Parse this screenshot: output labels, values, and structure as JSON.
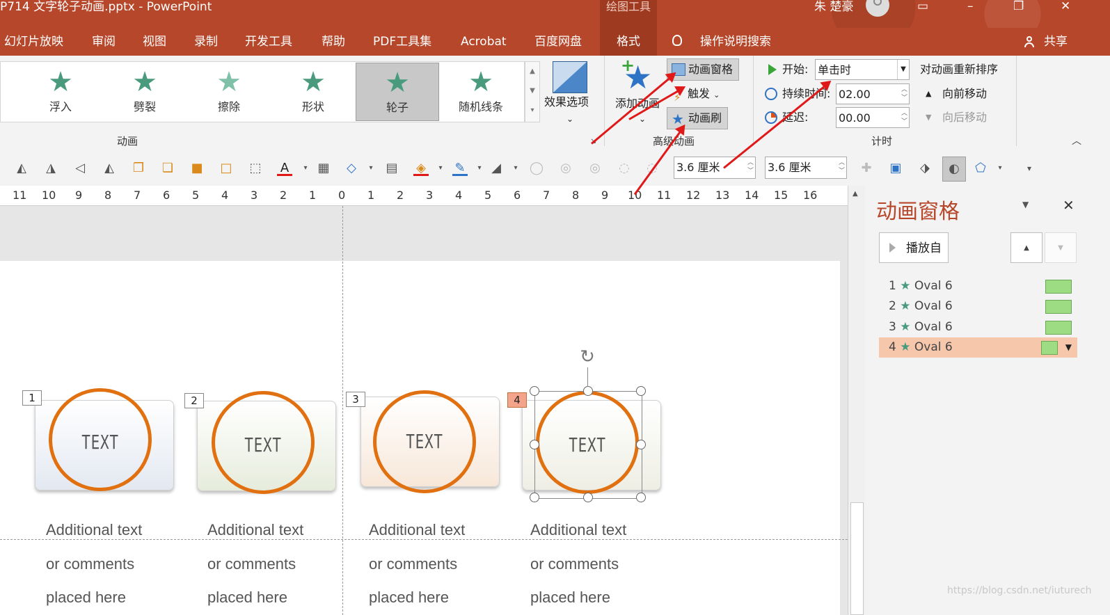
{
  "window": {
    "title": "P714 文字轮子动画.pptx  -  PowerPoint",
    "context_tab": "绘图工具",
    "user": "朱 楚豪",
    "controls": [
      "▭",
      "–",
      "❐",
      "✕"
    ]
  },
  "menu": {
    "items": [
      "幻灯片放映",
      "审阅",
      "视图",
      "录制",
      "开发工具",
      "帮助",
      "PDF工具集",
      "Acrobat",
      "百度网盘",
      "格式"
    ],
    "search": "操作说明搜索",
    "share": "共享"
  },
  "ribbon": {
    "gallery": [
      {
        "label": "浮入",
        "icon": "float-in-star-icon"
      },
      {
        "label": "劈裂",
        "icon": "split-star-icon"
      },
      {
        "label": "擦除",
        "icon": "wipe-star-icon"
      },
      {
        "label": "形状",
        "icon": "shape-star-icon"
      },
      {
        "label": "轮子",
        "icon": "wheel-star-icon",
        "selected": true
      },
      {
        "label": "随机线条",
        "icon": "random-bars-star-icon"
      }
    ],
    "effect_options": "效果选项",
    "effect_options_arrow": "⌄",
    "group_animation": "动画",
    "add_animation": "添加动画",
    "add_animation_arrow": "⌄",
    "animation_pane_btn": "动画窗格",
    "trigger": "触发",
    "trigger_arrow": "⌄",
    "animation_painter": "动画刷",
    "group_advanced": "高级动画",
    "start_label": "开始:",
    "start_value": "单击时",
    "duration_label": "持续时间:",
    "duration_value": "02.00",
    "delay_label": "延迟:",
    "delay_value": "00.00",
    "group_timing": "计时",
    "reorder_title": "对动画重新排序",
    "move_earlier": "向前移动",
    "move_later": "向后移动",
    "collapse": "︿"
  },
  "toolbar": {
    "height_value": "3.6 厘米",
    "width_value": "3.6 厘米"
  },
  "ruler": {
    "ticks": [
      "11",
      "10",
      "9",
      "8",
      "7",
      "6",
      "5",
      "4",
      "3",
      "2",
      "1",
      "0",
      "1",
      "2",
      "3",
      "4",
      "5",
      "6",
      "7",
      "8",
      "9",
      "10",
      "11",
      "12",
      "13",
      "14",
      "15",
      "16"
    ]
  },
  "slide": {
    "cards": [
      {
        "num": "1",
        "text": "TEXT",
        "line1": "Additional text",
        "line2": "or comments",
        "line3": "placed here",
        "fill": "#e3e8f1"
      },
      {
        "num": "2",
        "text": "TEXT",
        "line1": "Additional text",
        "line2": "or comments",
        "line3": "placed here",
        "fill": "#e6ecdc"
      },
      {
        "num": "3",
        "text": "TEXT",
        "line1": "Additional text",
        "line2": "or comments",
        "line3": "placed here",
        "fill": "#f7e7d9"
      },
      {
        "num": "4",
        "text": "TEXT",
        "line1": "Additional text",
        "line2": "or comments",
        "line3": "placed here",
        "fill": "#eeeee4"
      }
    ],
    "ring_color": "#e07010"
  },
  "pane": {
    "title": "动画窗格",
    "play_from": "播放自",
    "items": [
      {
        "num": "1",
        "name": "Oval 6"
      },
      {
        "num": "2",
        "name": "Oval 6"
      },
      {
        "num": "3",
        "name": "Oval 6"
      },
      {
        "num": "4",
        "name": "Oval 6",
        "selected": true
      }
    ],
    "watermark": "https://blog.csdn.net/iuturech"
  },
  "colors": {
    "accent": "#b7472a",
    "arrow": "#e01818",
    "swatch": "#9edc84",
    "selection": "#f6c7ab"
  }
}
